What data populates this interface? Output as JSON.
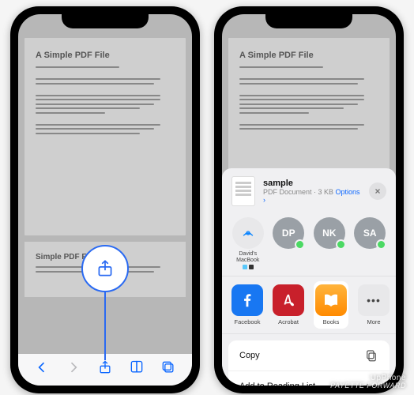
{
  "watermark": {
    "line1": "UpPhone",
    "line2": "PAYETTE FORWARD"
  },
  "pdf": {
    "title1": "A Simple PDF File",
    "title2": "Simple PDF File 2"
  },
  "share_sheet": {
    "file_name": "sample",
    "file_meta_prefix": "PDF Document · 3 KB  ",
    "file_options": "Options ›",
    "airdrop": [
      {
        "label": "David's MacBook",
        "type": "device"
      },
      {
        "label": "",
        "initials": "DP"
      },
      {
        "label": "",
        "initials": "NK"
      },
      {
        "label": "",
        "initials": "SA"
      }
    ],
    "apps": [
      {
        "label": "Facebook"
      },
      {
        "label": "Acrobat"
      },
      {
        "label": "Books"
      },
      {
        "label": "More"
      }
    ],
    "actions": [
      {
        "label": "Copy",
        "icon": "copy"
      },
      {
        "label": "Add to Reading List",
        "icon": "glasses"
      }
    ]
  }
}
